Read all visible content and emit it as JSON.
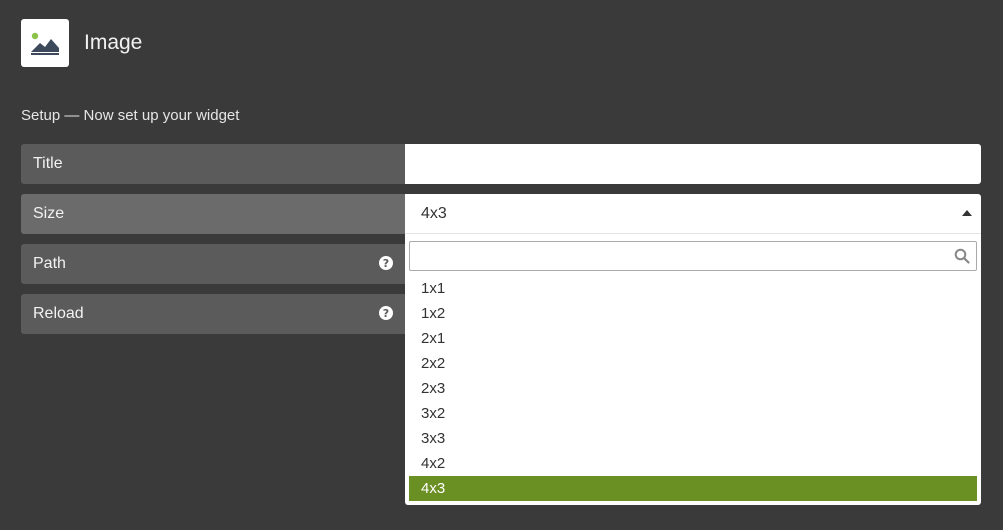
{
  "app": {
    "title": "Image",
    "icon": "image-icon",
    "accent": "#6a8f22"
  },
  "setup": {
    "heading": "Setup — Now set up your widget"
  },
  "fields": {
    "title": {
      "label": "Title",
      "value": "",
      "placeholder": ""
    },
    "size": {
      "label": "Size",
      "value": "4x3"
    },
    "path": {
      "label": "Path",
      "help_icon": "help-icon"
    },
    "reload": {
      "label": "Reload",
      "help_icon": "help-icon"
    }
  },
  "dropdown": {
    "search_value": "",
    "search_icon": "search-icon",
    "options": [
      "1x1",
      "1x2",
      "2x1",
      "2x2",
      "2x3",
      "3x2",
      "3x3",
      "4x2",
      "4x3"
    ],
    "selected": "4x3"
  }
}
